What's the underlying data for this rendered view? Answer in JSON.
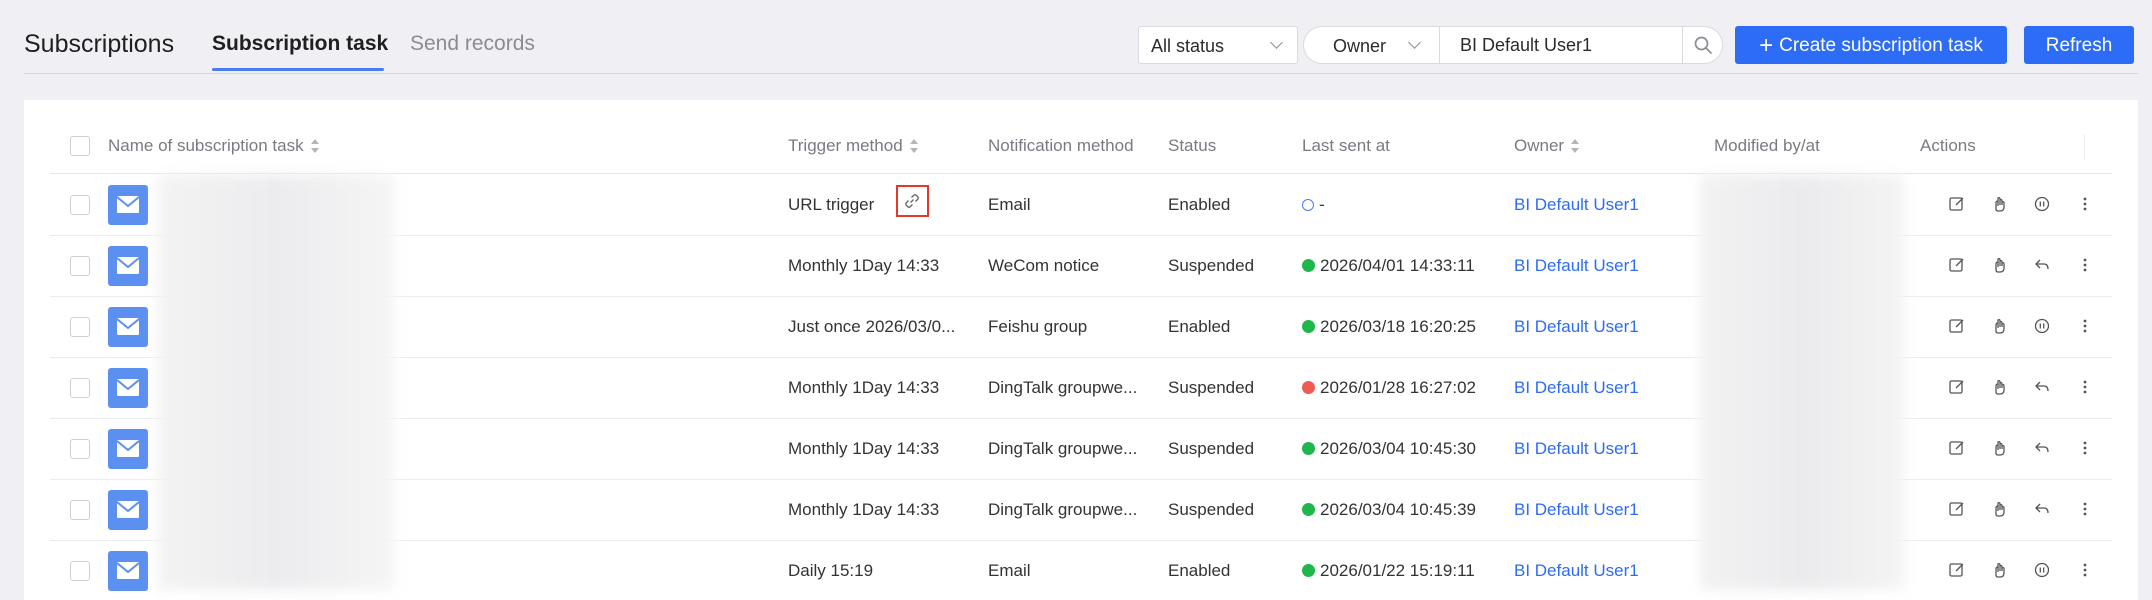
{
  "header": {
    "title": "Subscriptions",
    "tabs": [
      {
        "label": "Subscription task",
        "active": true
      },
      {
        "label": "Send records",
        "active": false
      }
    ],
    "filters": {
      "status": "All status",
      "owner_field": "Owner",
      "owner_value": "BI Default User1"
    },
    "create_label": "Create subscription task",
    "refresh_label": "Refresh",
    "accent_color": "#2c6cf6"
  },
  "table": {
    "columns": {
      "name": "Name of subscription task",
      "trigger": "Trigger method",
      "notification": "Notification method",
      "status": "Status",
      "last_sent": "Last sent at",
      "owner": "Owner",
      "modified": "Modified by/at",
      "actions": "Actions"
    },
    "rows": [
      {
        "trigger": "URL trigger",
        "notification": "Email",
        "status": "Enabled",
        "last_sent_icon": "clock-icon",
        "last_sent": "-",
        "owner": "BI Default User1"
      },
      {
        "trigger": "Monthly 1Day 14:33",
        "notification": "WeCom notice",
        "status": "Suspended",
        "last_sent_icon": "success-icon",
        "last_sent": "2026/04/01 14:33:11",
        "owner": "BI Default User1"
      },
      {
        "trigger": "Just once 2026/03/0...",
        "notification": "Feishu group",
        "status": "Enabled",
        "last_sent_icon": "success-icon",
        "last_sent": "2026/03/18 16:20:25",
        "owner": "BI Default User1"
      },
      {
        "trigger": "Monthly 1Day 14:33",
        "notification": "DingTalk groupwe...",
        "status": "Suspended",
        "last_sent_icon": "error-icon",
        "last_sent": "2026/01/28 16:27:02",
        "owner": "BI Default User1"
      },
      {
        "trigger": "Monthly 1Day 14:33",
        "notification": "DingTalk groupwe...",
        "status": "Suspended",
        "last_sent_icon": "success-icon",
        "last_sent": "2026/03/04 10:45:30",
        "owner": "BI Default User1"
      },
      {
        "trigger": "Monthly 1Day 14:33",
        "notification": "DingTalk groupwe...",
        "status": "Suspended",
        "last_sent_icon": "success-icon",
        "last_sent": "2026/03/04 10:45:39",
        "owner": "BI Default User1"
      },
      {
        "trigger": "Daily 15:19",
        "notification": "Email",
        "status": "Enabled",
        "last_sent_icon": "success-icon",
        "last_sent": "2026/01/22 15:19:11",
        "owner": "BI Default User1"
      }
    ]
  }
}
